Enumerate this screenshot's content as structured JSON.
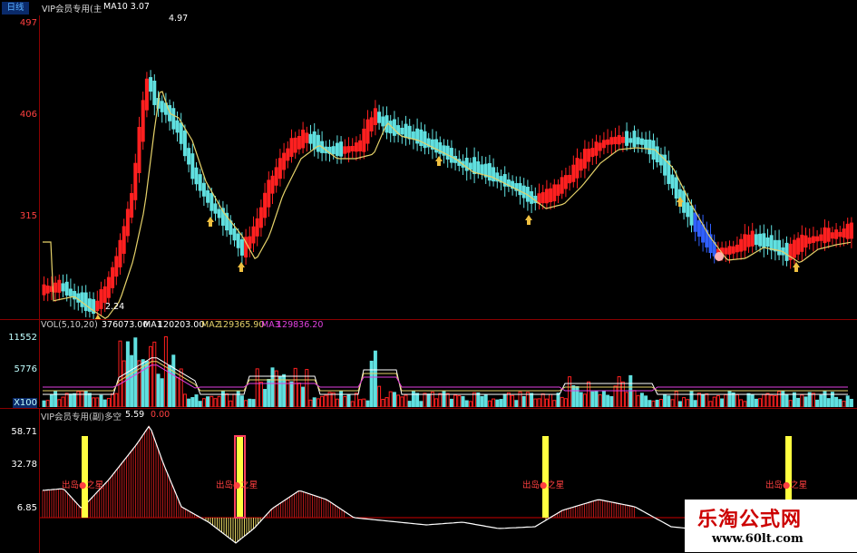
{
  "header": {
    "timeframe": "日线",
    "title": "VIP会员专用(主",
    "ma_label": "MA10 3.07"
  },
  "main_chart": {
    "axis_labels": [
      "497",
      "406",
      "315"
    ],
    "high_label": "4.97",
    "low_label": "2.24"
  },
  "volume_panel": {
    "title": "VOL(5,10,20)",
    "vol_value": "376073.00",
    "ma1_label": "MA1",
    "ma1_value": "120203.00",
    "ma2_label": "MA2",
    "ma2_value": "129365.90",
    "ma3_label": "MA3",
    "ma3_value": "129836.20",
    "axis_labels": [
      "11552",
      "5776"
    ],
    "unit_label": "X100"
  },
  "indicator_panel": {
    "title": "VIP会员专用(副)多空",
    "value1": "5.59",
    "value2": "0.00",
    "axis_labels": [
      "58.71",
      "32.78",
      "6.85"
    ],
    "signal_label": "出岛●之星"
  },
  "watermark": {
    "title": "乐淘公式网",
    "url": "www.60lt.com"
  },
  "colors": {
    "up": "#ff2020",
    "down": "#60e0e0",
    "ma": "#e6d26a",
    "grid": "#8a0000"
  }
}
